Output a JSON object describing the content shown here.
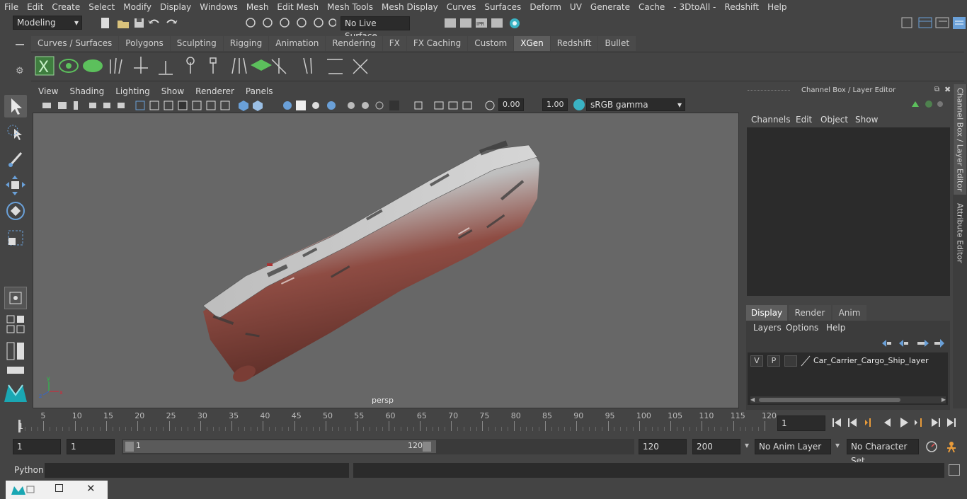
{
  "menubar": [
    "File",
    "Edit",
    "Create",
    "Select",
    "Modify",
    "Display",
    "Windows",
    "Mesh",
    "Edit Mesh",
    "Mesh Tools",
    "Mesh Display",
    "Curves",
    "Surfaces",
    "Deform",
    "UV",
    "Generate",
    "Cache",
    "- 3DtoAll -",
    "Redshift",
    "Help"
  ],
  "status": {
    "mode": "Modeling",
    "live_surface": "No Live Surface"
  },
  "shelf": {
    "tabs": [
      "Curves / Surfaces",
      "Polygons",
      "Sculpting",
      "Rigging",
      "Animation",
      "Rendering",
      "FX",
      "FX Caching",
      "Custom",
      "XGen",
      "Redshift",
      "Bullet"
    ],
    "active": "XGen",
    "icons": [
      "xgen-x-icon",
      "xgen-eye-icon",
      "xgen-leaf-icon",
      "xgen-guides-icon",
      "xgen-move-icon",
      "xgen-add-guide-icon",
      "xgen-sculpt-guide-icon",
      "xgen-lock-icon",
      "xgen-comb-icon",
      "xgen-grid-icon",
      "xgen-scale-icon",
      "xgen-cut-icon",
      "xgen-flat-icon",
      "xgen-noise-icon"
    ]
  },
  "viewport": {
    "menu": [
      "View",
      "Shading",
      "Lighting",
      "Show",
      "Renderer",
      "Panels"
    ],
    "exposure": "0.00",
    "gamma": "1.00",
    "color_space": "sRGB gamma",
    "camera_label": "persp"
  },
  "channel_box": {
    "title": "Channel Box / Layer Editor",
    "menu": [
      "Channels",
      "Edit",
      "Object",
      "Show"
    ]
  },
  "layer_editor": {
    "tabs": [
      "Display",
      "Render",
      "Anim"
    ],
    "active": "Display",
    "menu": [
      "Layers",
      "Options",
      "Help"
    ],
    "layer": {
      "v": "V",
      "p": "P",
      "name": "Car_Carrier_Cargo_Ship_layer"
    }
  },
  "side_tabs": [
    "Channel Box / Layer Editor",
    "Attribute Editor"
  ],
  "timeline": {
    "ticks": [
      5,
      10,
      15,
      20,
      25,
      30,
      35,
      40,
      45,
      50,
      55,
      60,
      65,
      70,
      75,
      80,
      85,
      90,
      95,
      100,
      105,
      110,
      115,
      120
    ],
    "start_label": "1",
    "current_frame": "1"
  },
  "range": {
    "start": "1",
    "playback_start": "1",
    "slider_start": "1",
    "slider_end": "120",
    "end": "120",
    "anim_end": "200",
    "anim_layer": "No Anim Layer",
    "character_set": "No Character Set"
  },
  "command_line": {
    "label": "Python"
  }
}
